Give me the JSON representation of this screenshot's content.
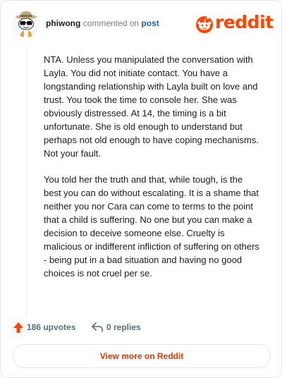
{
  "header": {
    "username": "phiwong",
    "action_text": "commented on",
    "post_link": "post",
    "brand": "reddit",
    "icons": {
      "avatar": "snoo-avatar",
      "logo": "reddit-logo-icon"
    },
    "colors": {
      "brand": "#ff4500",
      "link": "#1a5fb4"
    }
  },
  "comment": {
    "paragraphs": [
      "NTA. Unless you manipulated the conversation with Layla. You did not initiate contact. You have a longstanding relationship with Layla built on love and trust. You took the time to console her. She was obviously distressed. At 14, the timing is a bit unfortunate. She is old enough to understand but perhaps not old enough to have coping mechanisms. Not your fault.",
      "You told her the truth and that, while tough, is the best you can do without escalating. It is a shame that neither you nor Cara can come to terms to the point that a child is suffering. No one but you can make a decision to deceive someone else. Cruelty is malicious or indifferent infliction of suffering on others - being put in a bad situation and having no good choices is not cruel per se."
    ]
  },
  "actions": {
    "upvotes": "186 upvotes",
    "replies": "0 replies",
    "icons": {
      "upvote": "upvote-arrow-icon",
      "reply": "reply-arrow-icon"
    }
  },
  "footer": {
    "button_label": "View more on Reddit"
  }
}
